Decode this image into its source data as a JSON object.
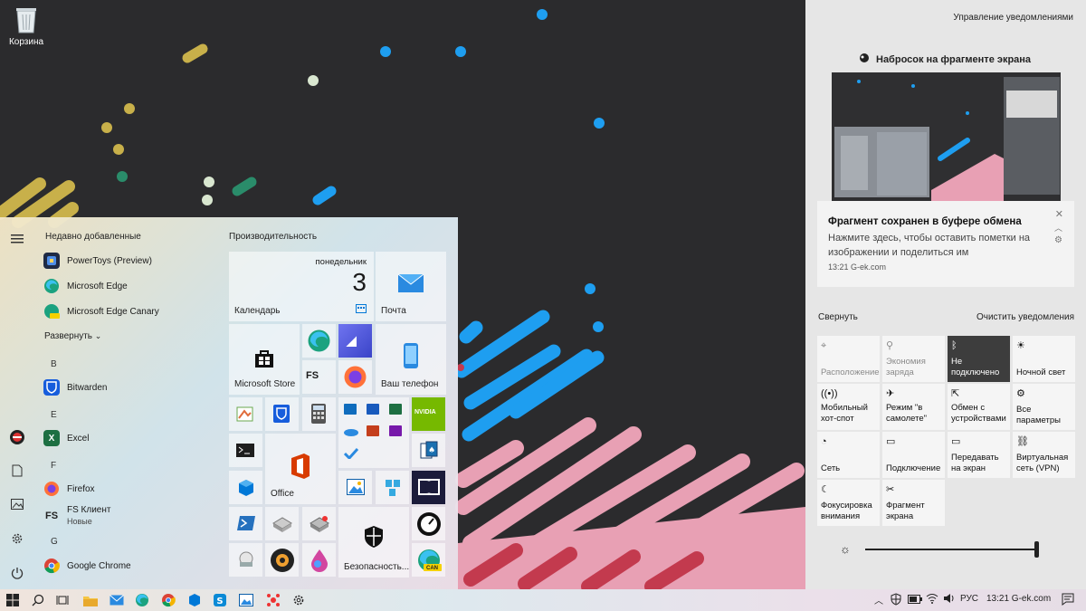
{
  "desktop": {
    "recycle_bin_label": "Корзина"
  },
  "start": {
    "recent_title": "Недавно добавленные",
    "recent_apps": [
      "PowerToys (Preview)",
      "Microsoft Edge",
      "Microsoft Edge Canary"
    ],
    "expand_label": "Развернуть",
    "groups": [
      {
        "letter": "B",
        "apps": [
          {
            "name": "Bitwarden"
          }
        ]
      },
      {
        "letter": "E",
        "apps": [
          {
            "name": "Excel"
          }
        ]
      },
      {
        "letter": "F",
        "apps": [
          {
            "name": "Firefox"
          },
          {
            "name": "FS Клиент",
            "sub": "Новые"
          }
        ]
      },
      {
        "letter": "G",
        "apps": [
          {
            "name": "Google Chrome"
          }
        ]
      }
    ],
    "tiles_title": "Производительность",
    "calendar": {
      "label": "Календарь",
      "weekday": "понедельник",
      "day": "3"
    },
    "mail_label": "Почта",
    "store_label": "Microsoft Store",
    "phone_label": "Ваш телефон",
    "office_label": "Office",
    "security_label": "Безопасность...",
    "fs_badge": "FS",
    "nvidia_label": "NVIDIA",
    "can_badge": "CAN"
  },
  "action_center": {
    "manage_label": "Управление уведомлениями",
    "snip_app": "Набросок на фрагменте экрана",
    "toast": {
      "title": "Фрагмент сохранен в буфере обмена",
      "body": "Нажмите здесь, чтобы оставить пометки на изображении и поделиться им",
      "meta": "13:21 G-ek.com"
    },
    "collapse_label": "Свернуть",
    "clear_label": "Очистить уведомления",
    "quick_actions": [
      {
        "label": "Расположение",
        "icon": "location-icon",
        "state": "dim"
      },
      {
        "label": "Экономия заряда",
        "icon": "battery-saver-icon",
        "state": "dim"
      },
      {
        "label": "Не подключено",
        "icon": "bluetooth-icon",
        "state": "on"
      },
      {
        "label": "Ночной свет",
        "icon": "night-light-icon",
        "state": "normal"
      },
      {
        "label": "Мобильный хот-спот",
        "icon": "hotspot-icon",
        "state": "normal"
      },
      {
        "label": "Режим \"в самолете\"",
        "icon": "airplane-icon",
        "state": "normal"
      },
      {
        "label": "Обмен с устройствами",
        "icon": "share-icon",
        "state": "normal"
      },
      {
        "label": "Все параметры",
        "icon": "settings-icon",
        "state": "normal"
      },
      {
        "label": "Сеть",
        "icon": "network-icon",
        "state": "normal"
      },
      {
        "label": "Подключение",
        "icon": "connect-icon",
        "state": "normal"
      },
      {
        "label": "Передавать на экран",
        "icon": "project-icon",
        "state": "normal"
      },
      {
        "label": "Виртуальная сеть (VPN)",
        "icon": "vpn-icon",
        "state": "normal"
      },
      {
        "label": "Фокусировка внимания",
        "icon": "focus-assist-icon",
        "state": "normal"
      },
      {
        "label": "Фрагмент экрана",
        "icon": "screen-snip-icon",
        "state": "normal"
      }
    ],
    "brightness": 1.0
  },
  "taskbar": {
    "language": "РУС",
    "clock": "13:21 G-ek.com"
  },
  "colors": {
    "accent": "#0078d7",
    "dark": "#2b2b2d",
    "pink": "#e8a0b4",
    "blue": "#1e9ef0"
  }
}
